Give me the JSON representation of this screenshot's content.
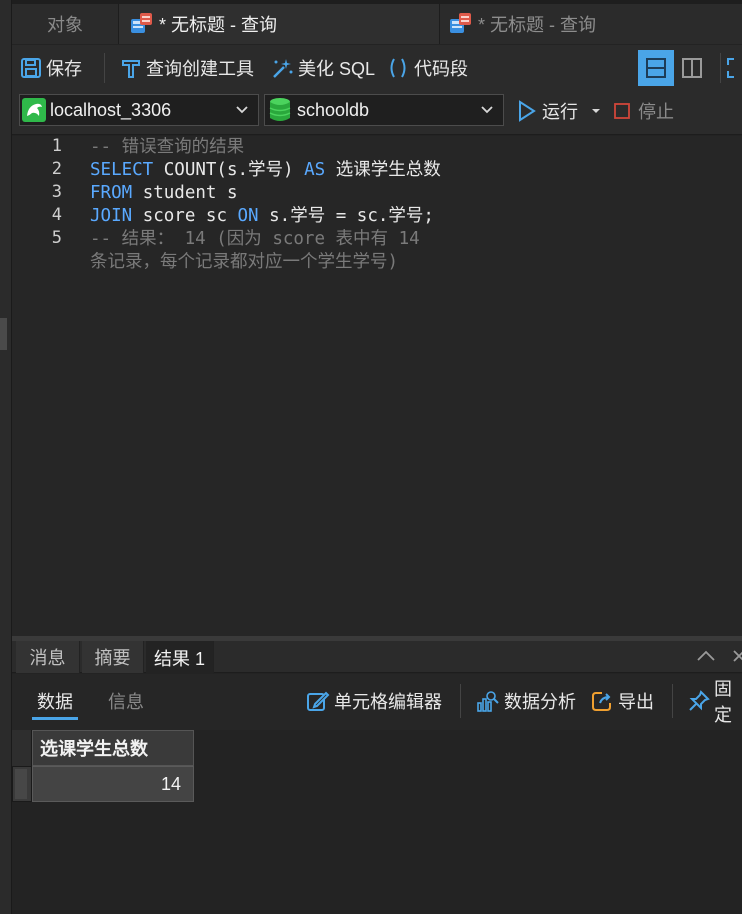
{
  "tabs": {
    "objects": "对象",
    "query1": "* 无标题 - 查询",
    "query2": "* 无标题 - 查询"
  },
  "toolbar": {
    "save": "保存",
    "query_builder": "查询创建工具",
    "beautify_sql": "美化 SQL",
    "snippet": "代码段"
  },
  "connection": {
    "server": "localhost_3306",
    "database": "schooldb",
    "run": "运行",
    "stop": "停止"
  },
  "editor": {
    "line_numbers": [
      "1",
      "2",
      "3",
      "4",
      "5"
    ],
    "lines": [
      {
        "parts": [
          [
            "cmt",
            "-- 错误查询的结果"
          ]
        ]
      },
      {
        "parts": [
          [
            "kw",
            "SELECT"
          ],
          [
            "plain",
            " COUNT(s.学号) "
          ],
          [
            "kw",
            "AS"
          ],
          [
            "plain",
            " 选课学生总数"
          ]
        ]
      },
      {
        "parts": [
          [
            "kw",
            "FROM"
          ],
          [
            "plain",
            " student s"
          ]
        ]
      },
      {
        "parts": [
          [
            "kw",
            "JOIN"
          ],
          [
            "plain",
            " score sc "
          ],
          [
            "kw",
            "ON"
          ],
          [
            "plain",
            " s.学号 = sc.学号;"
          ]
        ]
      },
      {
        "parts": [
          [
            "cmt",
            "-- 结果： 14 (因为 score 表中有 14"
          ]
        ]
      },
      {
        "parts": [
          [
            "cmt",
            "条记录，每个记录都对应一个学生学号)"
          ]
        ]
      }
    ]
  },
  "result_tabs": {
    "messages": "消息",
    "summary": "摘要",
    "result1": "结果 1"
  },
  "result_toolbar": {
    "data": "数据",
    "info": "信息",
    "cell_editor": "单元格编辑器",
    "data_analysis": "数据分析",
    "export": "导出",
    "pin": "固定"
  },
  "grid": {
    "columns": [
      "选课学生总数"
    ],
    "rows": [
      [
        "14"
      ]
    ]
  },
  "colors": {
    "keyword": "#5aa9ff",
    "comment": "#7a7a7a",
    "accent": "#4aa5e8"
  }
}
